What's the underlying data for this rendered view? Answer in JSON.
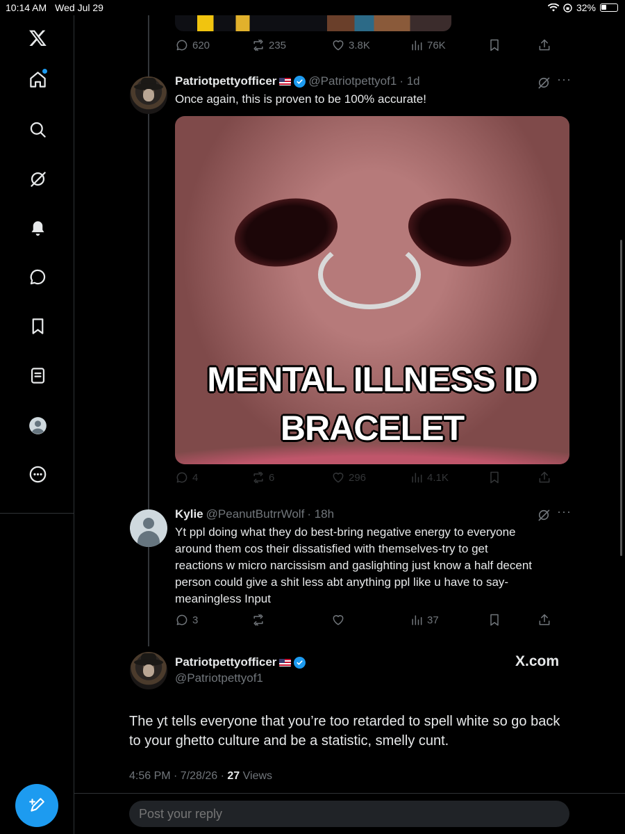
{
  "status_bar": {
    "time": "10:14 AM",
    "date": "Wed Jul 29",
    "battery": "32%"
  },
  "sidebar": {
    "items": [
      "x-logo",
      "home",
      "search",
      "grok",
      "notifications",
      "messages",
      "bookmarks",
      "lists",
      "profile",
      "more"
    ]
  },
  "top_tweet_actions": {
    "replies": "620",
    "reposts": "235",
    "likes": "3.8K",
    "views": "76K"
  },
  "tweet1": {
    "name": "Patriotpettyofficer",
    "handle": "@Patriotpettyof1",
    "time": "· 1d",
    "text": "Once again, this is proven to be 100% accurate!",
    "image_caption_line1": "MENTAL ILLNESS ID",
    "image_caption_line2": "BRACELET",
    "replies": "4",
    "reposts": "6",
    "likes": "296",
    "views": "4.1K"
  },
  "tweet2": {
    "name": "Kylie",
    "handle": "@PeanutButrrWolf",
    "time": "· 18h",
    "lines": [
      "Yt ppl doing what they do best-bring negative energy to everyone",
      "around them cos their dissatisfied with themselves-try to get",
      "reactions w micro narcissism and gaslighting just know a half decent",
      "person could give a shit less abt anything ppl like u have to say-",
      "meaningless Input"
    ],
    "replies": "3",
    "views": "37"
  },
  "main_tweet": {
    "name": "Patriotpettyofficer",
    "handle": "@Patriotpettyof1",
    "brand": "X.com",
    "lines": [
      "The yt tells everyone that you’re too retarded to spell white so go back",
      "to your ghetto culture and be a statistic, smelly cunt."
    ],
    "timestamp": "4:56 PM · 7/28/26 · ",
    "views_count": "27",
    "views_label": " Views"
  },
  "reply": {
    "placeholder": "Post your reply"
  },
  "colors": {
    "accent": "#1d9bf0",
    "muted": "#71767b",
    "background": "#000000"
  }
}
